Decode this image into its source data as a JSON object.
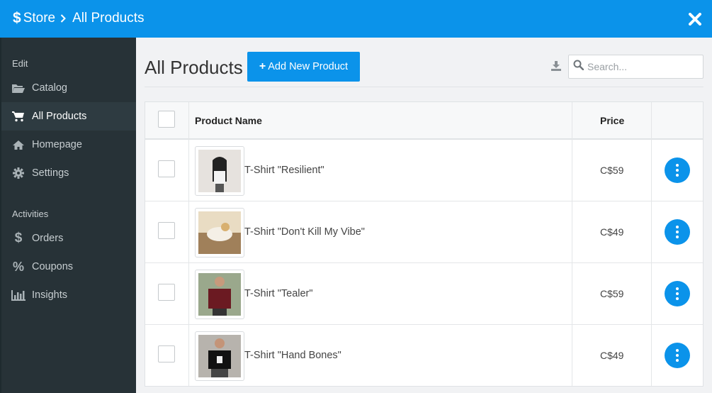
{
  "topbar": {
    "dollar_glyph": "$",
    "store_label": "Store",
    "page_label": "All Products",
    "close_icon": "close-icon"
  },
  "sidebar": {
    "edit_heading": "Edit",
    "edit_items": [
      {
        "label": "Catalog",
        "icon": "folder-open-icon",
        "active": false
      },
      {
        "label": "All Products",
        "icon": "cart-icon",
        "active": true
      },
      {
        "label": "Homepage",
        "icon": "home-icon",
        "active": false
      },
      {
        "label": "Settings",
        "icon": "gear-icon",
        "active": false
      }
    ],
    "activities_heading": "Activities",
    "activity_items": [
      {
        "label": "Orders",
        "icon": "dollar-icon"
      },
      {
        "label": "Coupons",
        "icon": "percent-icon"
      },
      {
        "label": "Insights",
        "icon": "bar-chart-icon"
      }
    ]
  },
  "main": {
    "title": "All Products",
    "add_button_label": "Add New Product",
    "search_placeholder": "Search...",
    "table": {
      "headers": {
        "name": "Product Name",
        "price": "Price"
      },
      "rows": [
        {
          "name": "T-Shirt \"Resilient\"",
          "price": "C$59"
        },
        {
          "name": "T-Shirt \"Don't Kill My Vibe\"",
          "price": "C$49"
        },
        {
          "name": "T-Shirt \"Tealer\"",
          "price": "C$59"
        },
        {
          "name": "T-Shirt \"Hand Bones\"",
          "price": "C$49"
        }
      ]
    }
  },
  "colors": {
    "accent": "#0b93ea",
    "sidebar_bg": "#273237",
    "sidebar_active_bg": "#2e3b41",
    "main_bg": "#f1f2f4"
  }
}
